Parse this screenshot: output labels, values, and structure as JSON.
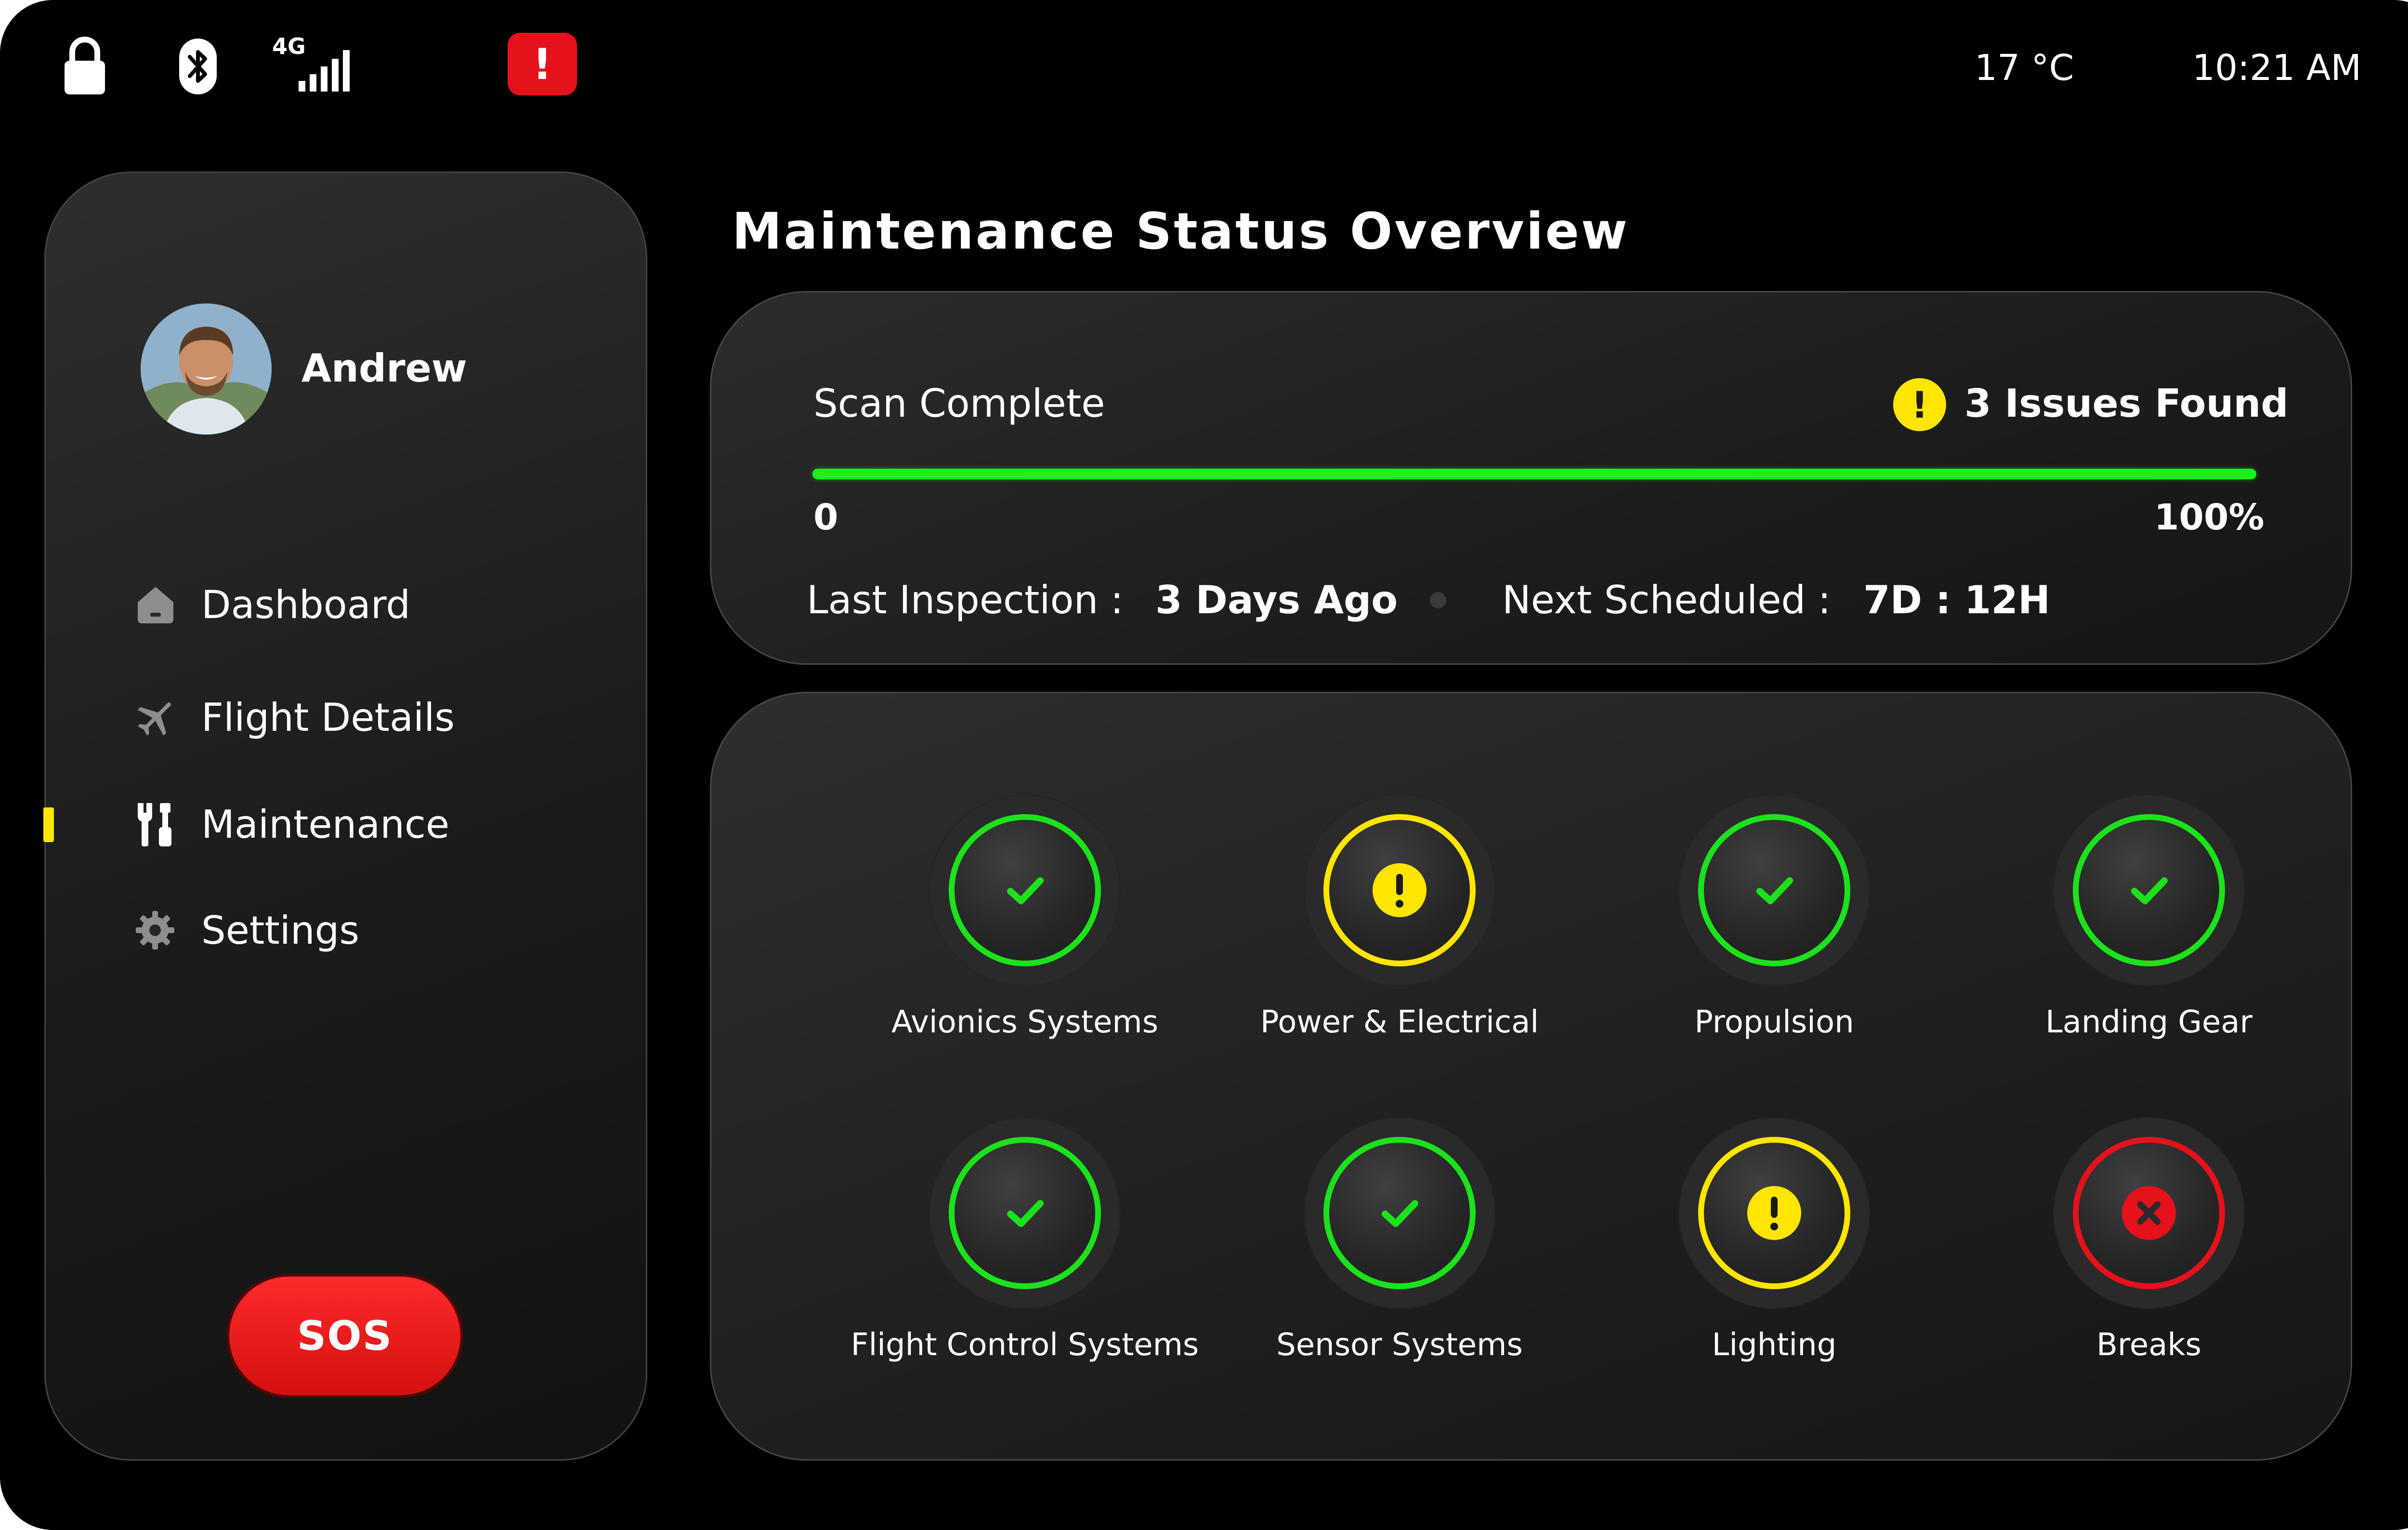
{
  "status_bar": {
    "icons": [
      "lock-icon",
      "bluetooth-icon",
      "signal-icon",
      "alert-icon"
    ],
    "network_label": "4G",
    "alert_symbol": "!",
    "temperature": "17 °C",
    "time": "10:21 AM"
  },
  "user": {
    "name": "Andrew",
    "avatar_icon": "user-avatar"
  },
  "sidebar": {
    "items": [
      {
        "label": "Dashboard",
        "icon": "home-icon",
        "active": false
      },
      {
        "label": "Flight Details",
        "icon": "airplane-icon",
        "active": false
      },
      {
        "label": "Maintenance",
        "icon": "tools-icon",
        "active": true
      },
      {
        "label": "Settings",
        "icon": "gear-icon",
        "active": false
      }
    ],
    "sos_label": "SOS"
  },
  "page": {
    "title": "Maintenance Status Overview"
  },
  "scan": {
    "status": "Scan Complete",
    "issues": "3 Issues Found",
    "warn_symbol": "!",
    "progress": 100,
    "start_label": "0",
    "end_label": "100%",
    "last_inspection_label": "Last Inspection :",
    "last_inspection_value": "3 Days Ago",
    "next_scheduled_label": "Next Scheduled :",
    "next_scheduled_value": "7D : 12H"
  },
  "systems": [
    {
      "label": "Avionics Systems",
      "status": "ok"
    },
    {
      "label": "Power & Electrical",
      "status": "warning"
    },
    {
      "label": "Propulsion",
      "status": "ok"
    },
    {
      "label": "Landing Gear",
      "status": "ok"
    },
    {
      "label": "Flight Control Systems",
      "status": "ok"
    },
    {
      "label": "Sensor Systems",
      "status": "ok"
    },
    {
      "label": "Lighting",
      "status": "warning"
    },
    {
      "label": "Breaks",
      "status": "error"
    }
  ],
  "colors": {
    "ok": "#1ce21c",
    "warning": "#ffe600",
    "error": "#e5121b",
    "accent": "#ffe600",
    "sos": "#e11818",
    "progress": "#1cf01c"
  }
}
